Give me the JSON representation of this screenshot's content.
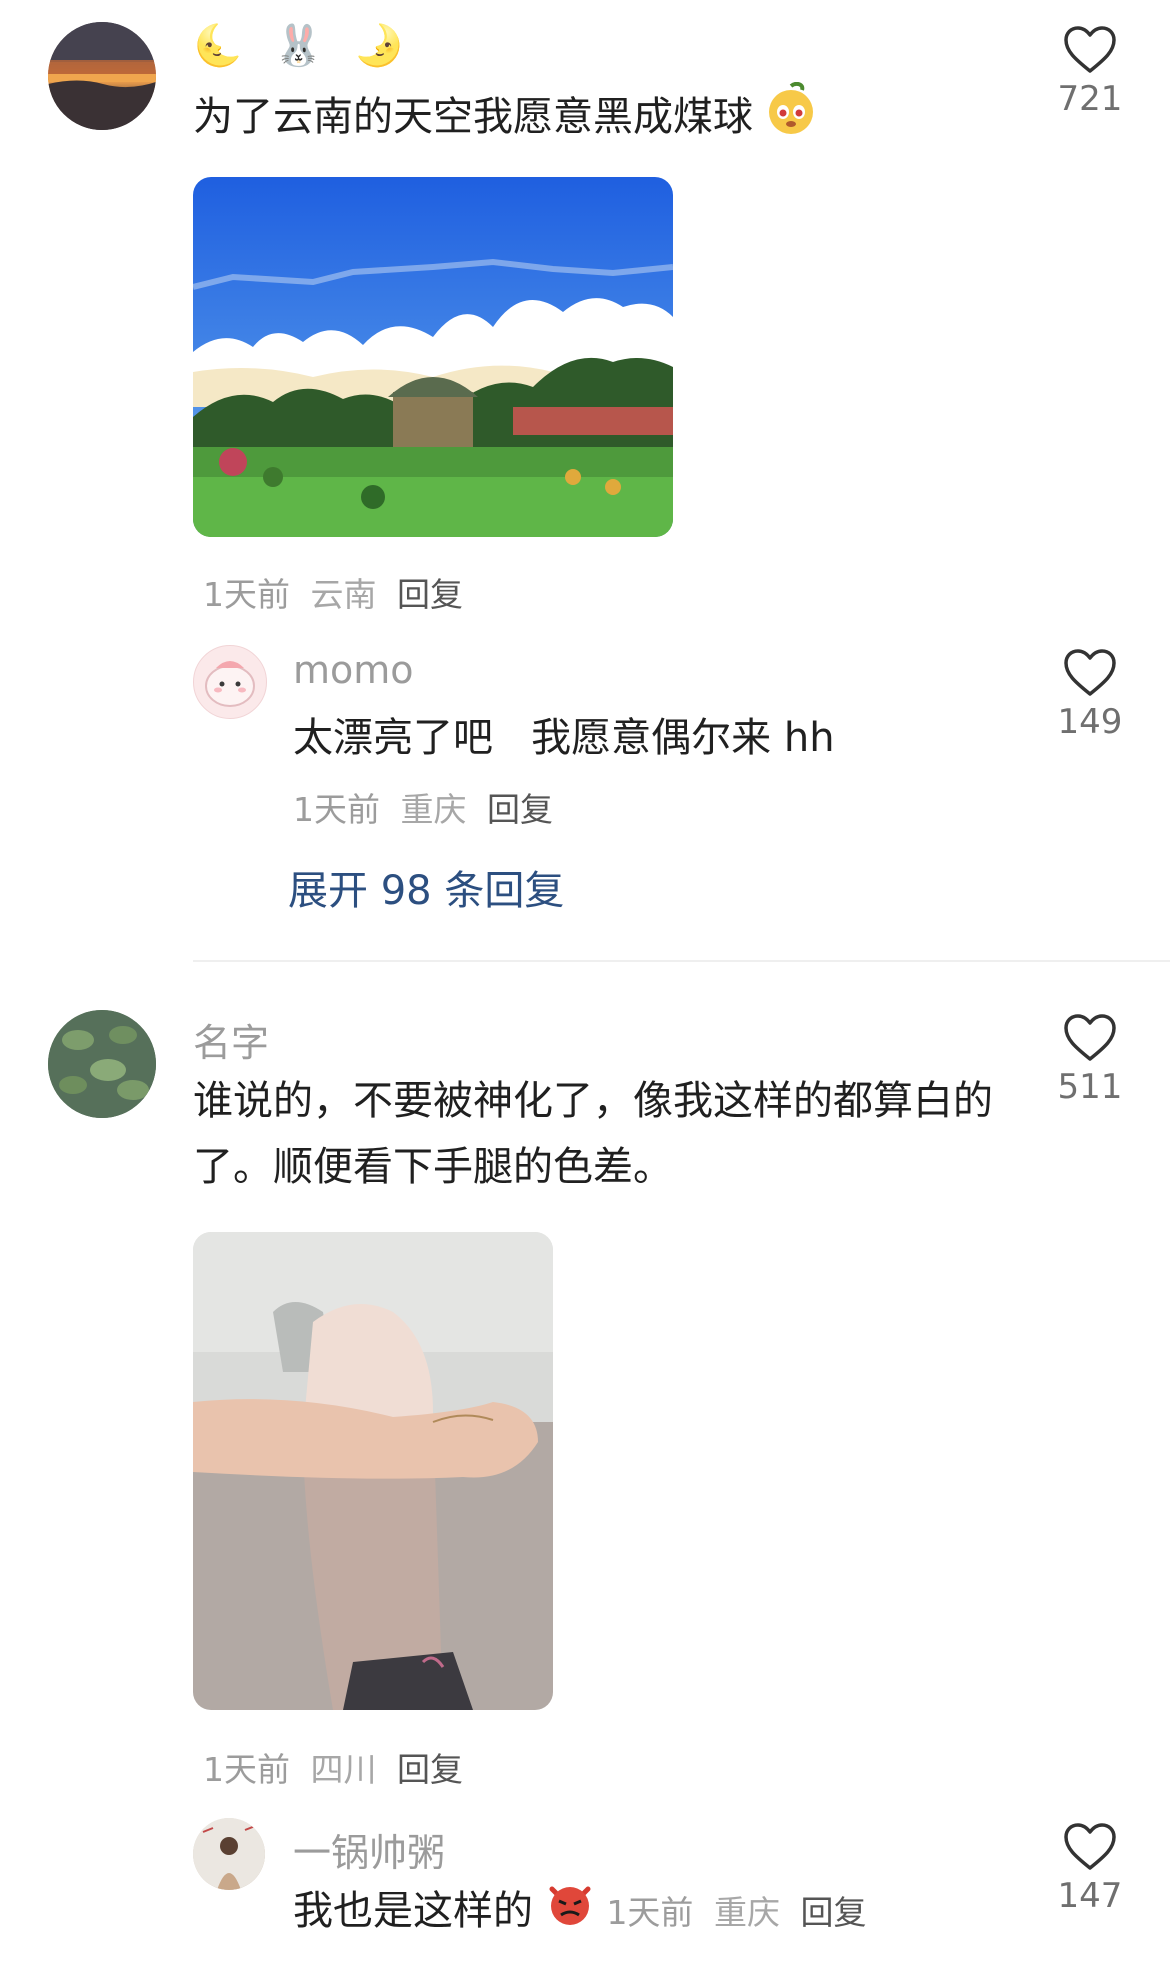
{
  "comments": [
    {
      "name_emoji": [
        "🌜",
        "🐰",
        "🌛"
      ],
      "text": "为了云南的天空我愿意黑成煤球",
      "time": "1天前",
      "location": "云南",
      "reply_label": "回复",
      "likes": "721",
      "reply": {
        "name": "momo",
        "text": "太漂亮了吧   我愿意偶尔来 hh",
        "time": "1天前",
        "location": "重庆",
        "reply_label": "回复",
        "likes": "149"
      },
      "expand_label": "展开 98 条回复"
    },
    {
      "name": "名字",
      "text": "谁说的，不要被神化了，像我这样的都算白的了。顺便看下手腿的色差。",
      "time": "1天前",
      "location": "四川",
      "reply_label": "回复",
      "likes": "511",
      "reply": {
        "name": "一锅帅粥",
        "text": "我也是这样的",
        "time": "1天前",
        "location": "重庆",
        "reply_label": "回复",
        "likes": "147"
      }
    }
  ],
  "colors": {
    "link": "#2c4f80",
    "meta": "#9c9c9c",
    "like_icon": "#333333"
  },
  "icons": {
    "like": "heart-outline-icon",
    "emoji_1": "mango-face-emoji",
    "emoji_2": "angry-devil-emoji"
  }
}
